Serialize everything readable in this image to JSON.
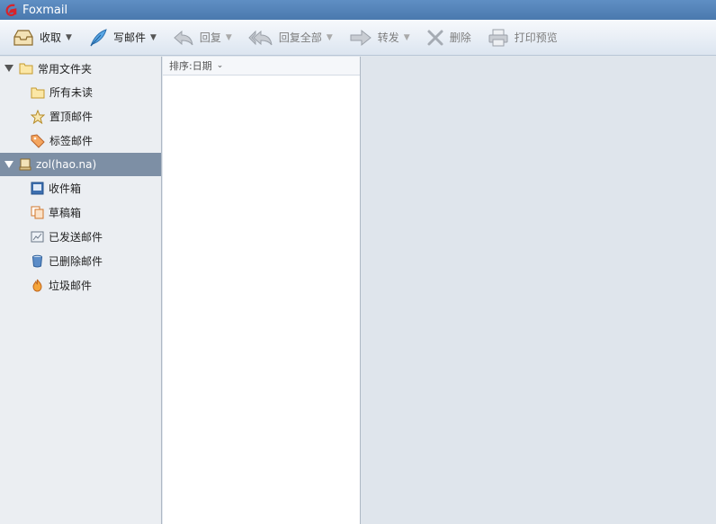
{
  "window": {
    "title": "Foxmail"
  },
  "toolbar": {
    "receive": "收取",
    "compose": "写邮件",
    "reply": "回复",
    "reply_all": "回复全部",
    "forward": "转发",
    "delete": "删除",
    "print_preview": "打印预览"
  },
  "sidebar": {
    "favorites": {
      "title": "常用文件夹",
      "items": [
        {
          "label": "所有未读",
          "icon": "folder-icon"
        },
        {
          "label": "置顶邮件",
          "icon": "star-icon"
        },
        {
          "label": "标签邮件",
          "icon": "tag-icon"
        }
      ]
    },
    "account": {
      "title": "zol(hao.na)",
      "items": [
        {
          "label": "收件箱",
          "icon": "inbox-icon"
        },
        {
          "label": "草稿箱",
          "icon": "drafts-icon"
        },
        {
          "label": "已发送邮件",
          "icon": "sent-icon"
        },
        {
          "label": "已删除邮件",
          "icon": "trash-icon"
        },
        {
          "label": "垃圾邮件",
          "icon": "junk-icon"
        }
      ]
    }
  },
  "list": {
    "sort_label": "排序:日期"
  },
  "colors": {
    "titlebar": "#4a79ae",
    "selected": "#7d8fa5",
    "sidebar": "#ebeef2",
    "preview": "#dfe5ec"
  }
}
